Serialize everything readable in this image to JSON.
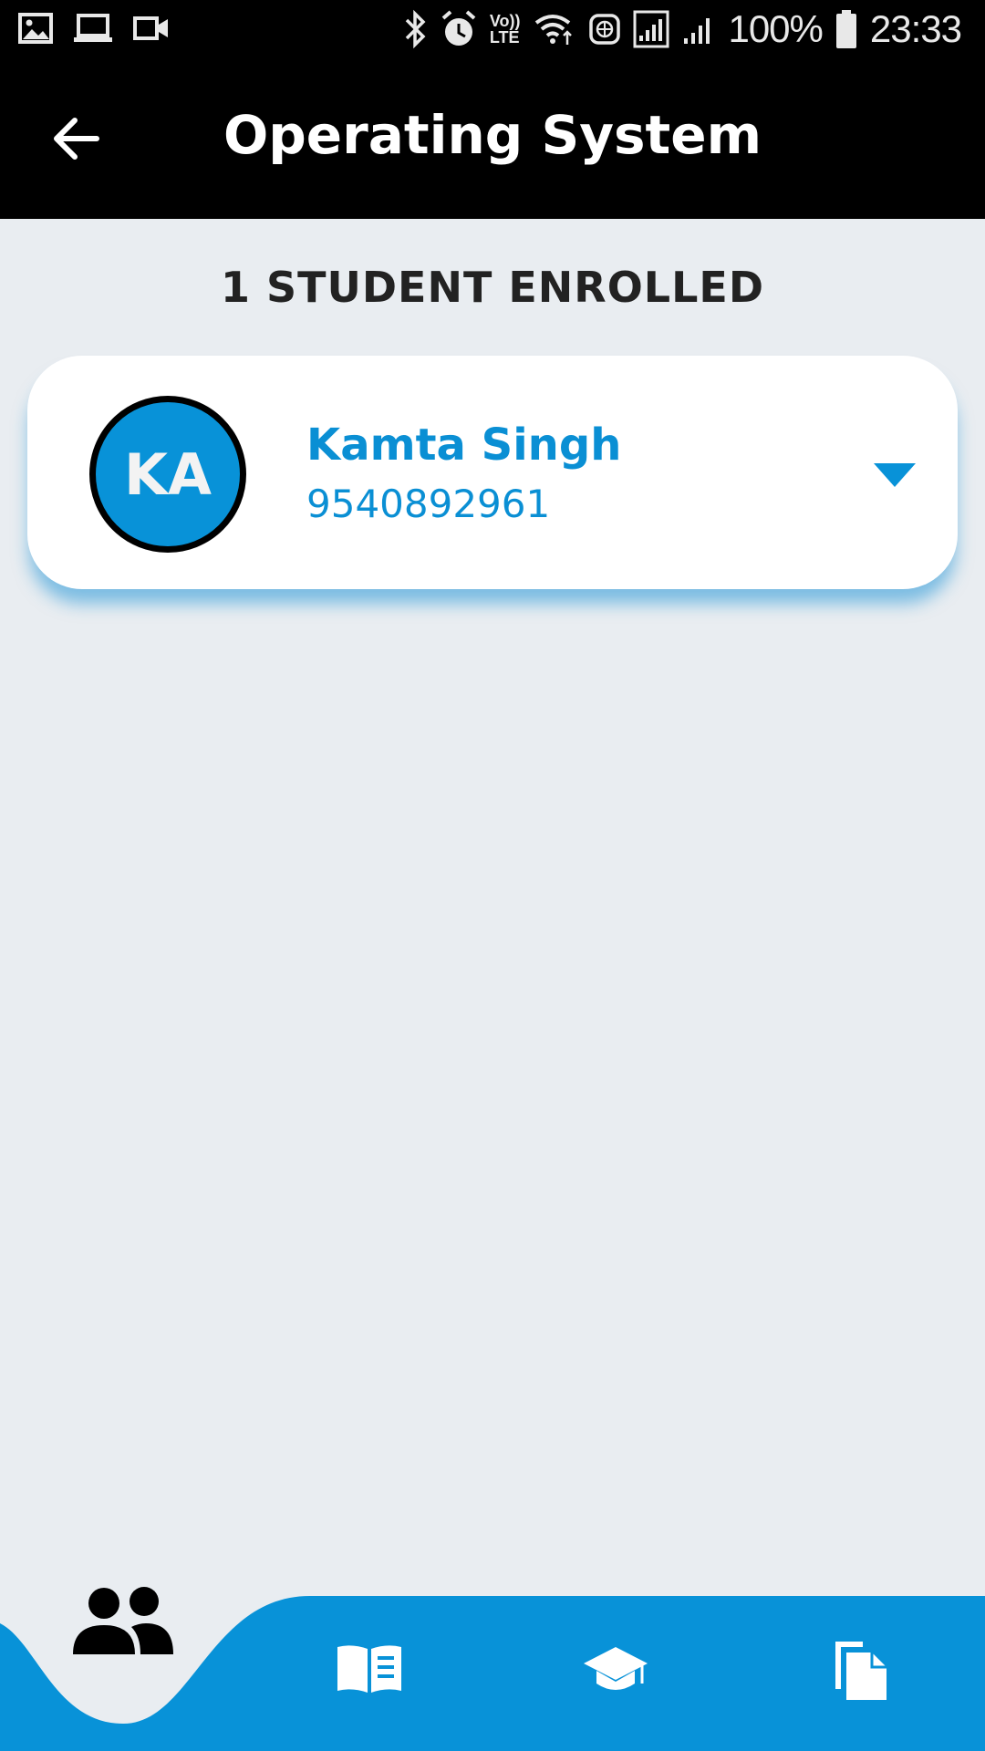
{
  "status_bar": {
    "battery": "100%",
    "time": "23:33",
    "left_icons": [
      "image-icon",
      "laptop-icon",
      "video-camera-icon"
    ],
    "right_icons": [
      "bluetooth-icon",
      "alarm-icon",
      "volte-icon",
      "wifi-icon",
      "globe-icon",
      "signal-icon",
      "signal-icon",
      "battery-icon"
    ],
    "volte_label_top": "Vo))",
    "volte_label_bottom": "LTE"
  },
  "header": {
    "title": "Operating System",
    "back_icon": "arrow-left-icon"
  },
  "enrollment": {
    "count_label": "1 STUDENT ENROLLED"
  },
  "students": [
    {
      "initials": "KA",
      "name": "Kamta Singh",
      "phone": "9540892961",
      "expand_icon": "caret-down-icon"
    }
  ],
  "bottom_nav": {
    "items": [
      {
        "icon": "people-icon",
        "active": true
      },
      {
        "icon": "book-icon",
        "active": false
      },
      {
        "icon": "graduation-cap-icon",
        "active": false
      },
      {
        "icon": "documents-icon",
        "active": false
      }
    ]
  },
  "colors": {
    "accent": "#0892d8",
    "header_bg": "#000000",
    "page_bg": "#e9edf1",
    "card_bg": "#ffffff",
    "name_text": "#0a8fd4"
  }
}
